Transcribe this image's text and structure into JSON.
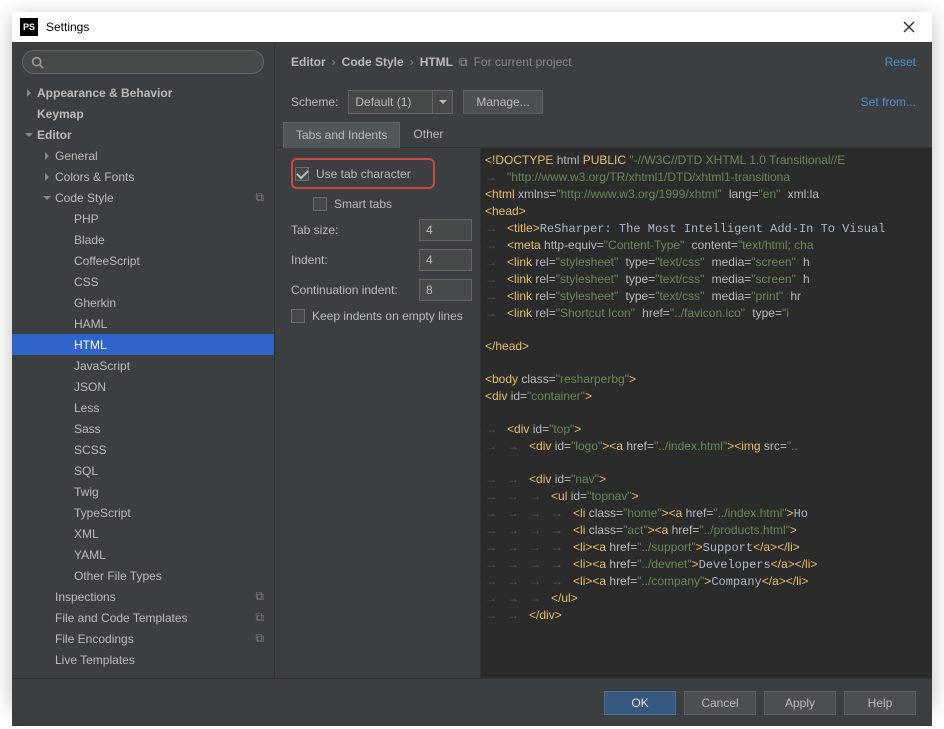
{
  "window": {
    "title": "Settings"
  },
  "header": {
    "breadcrumb": [
      "Editor",
      "Code Style",
      "HTML"
    ],
    "context": "For current project",
    "reset": "Reset"
  },
  "scheme": {
    "label": "Scheme:",
    "value": "Default (1)",
    "manage": "Manage...",
    "setfrom": "Set from..."
  },
  "tabs": {
    "tab1": "Tabs and Indents",
    "tab2": "Other"
  },
  "options": {
    "use_tab_char": "Use tab character",
    "smart_tabs": "Smart tabs",
    "tab_size_label": "Tab size:",
    "tab_size": "4",
    "indent_label": "Indent:",
    "indent": "4",
    "cont_label": "Continuation indent:",
    "cont": "8",
    "keep_empty": "Keep indents on empty lines"
  },
  "tree": {
    "appearance": "Appearance & Behavior",
    "keymap": "Keymap",
    "editor": "Editor",
    "general": "General",
    "colors": "Colors & Fonts",
    "codestyle": "Code Style",
    "langs": [
      "PHP",
      "Blade",
      "CoffeeScript",
      "CSS",
      "Gherkin",
      "HAML",
      "HTML",
      "JavaScript",
      "JSON",
      "Less",
      "Sass",
      "SCSS",
      "SQL",
      "Twig",
      "TypeScript",
      "XML",
      "YAML",
      "Other File Types"
    ],
    "inspections": "Inspections",
    "filetpl": "File and Code Templates",
    "fileenc": "File Encodings",
    "livetpl": "Live Templates"
  },
  "footer": {
    "ok": "OK",
    "cancel": "Cancel",
    "apply": "Apply",
    "help": "Help"
  }
}
